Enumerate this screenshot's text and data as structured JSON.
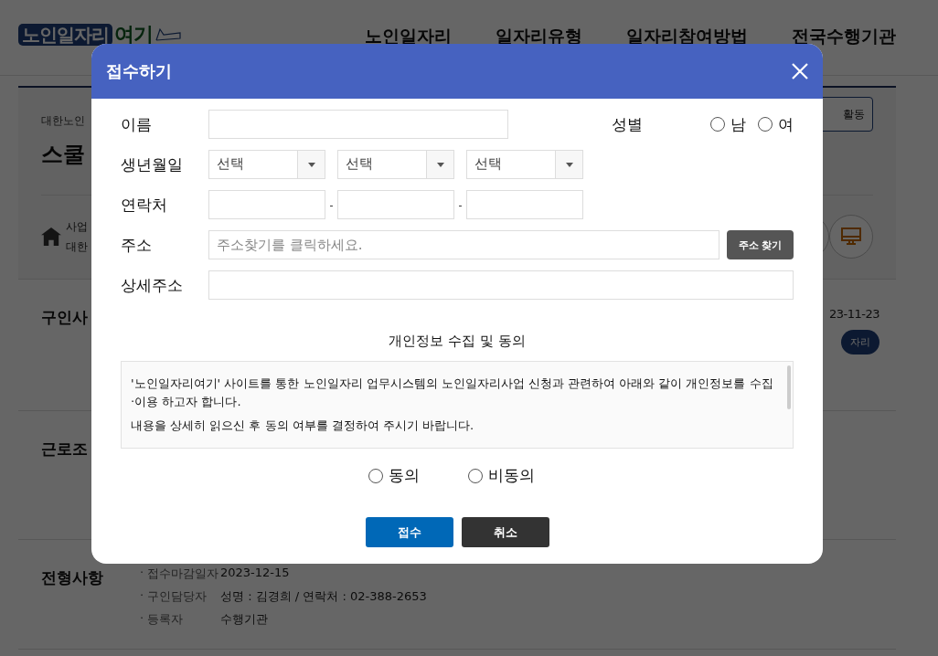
{
  "header": {
    "logo": {
      "main": "노인일자리",
      "accent": "여기"
    },
    "nav": [
      "노인일자리",
      "일자리유형",
      "일자리참여방법",
      "전국수행기관"
    ]
  },
  "background": {
    "org": "대한노인",
    "title": "스쿨",
    "action": "활동",
    "place": [
      "사업",
      "대한"
    ],
    "date": "23-11-23",
    "badge": "자리",
    "sections": [
      {
        "title": "구인사"
      },
      {
        "title": "근로조"
      },
      {
        "title": "전형사항",
        "items": [
          {
            "bullet": "·",
            "label": "접수마감일자",
            "value": "2023-12-15"
          },
          {
            "bullet": "·",
            "label": "구인담당자",
            "value": "성명 : 김경희 / 연락처 : 02-388-2653"
          },
          {
            "bullet": "·",
            "label": "등록자",
            "value": "수행기관"
          }
        ]
      }
    ]
  },
  "dialog": {
    "title": "접수하기",
    "name": {
      "label": "이름"
    },
    "gender": {
      "label": "성별",
      "options": [
        {
          "label": "남",
          "selected": false
        },
        {
          "label": "여",
          "selected": false
        }
      ]
    },
    "birth": {
      "label": "생년월일",
      "selects": [
        "선택",
        "선택",
        "선택"
      ]
    },
    "contact": {
      "label": "연락처",
      "separators": [
        "-",
        "-"
      ]
    },
    "address": {
      "label": "주소",
      "placeholder": "주소찾기를 클릭하세요.",
      "button": "주소 찾기"
    },
    "detail": {
      "label": "상세주소"
    },
    "consent": {
      "heading": "개인정보 수집 및 동의",
      "paragraphs": [
        "'노인일자리여기' 사이트를 통한 노인일자리 업무시스템의 노인일자리사업 신청과 관련하여 아래와 같이 개인정보를 수집 ·이용 하고자 합니다.",
        "내용을 상세히 읽으신 후 동의 여부를 결정하여 주시기 바랍니다."
      ],
      "options": [
        {
          "label": "동의",
          "selected": false
        },
        {
          "label": "비동의",
          "selected": false
        }
      ]
    },
    "buttons": [
      {
        "label": "접수",
        "kind": "primary"
      },
      {
        "label": "취소",
        "kind": "secondary"
      }
    ]
  }
}
